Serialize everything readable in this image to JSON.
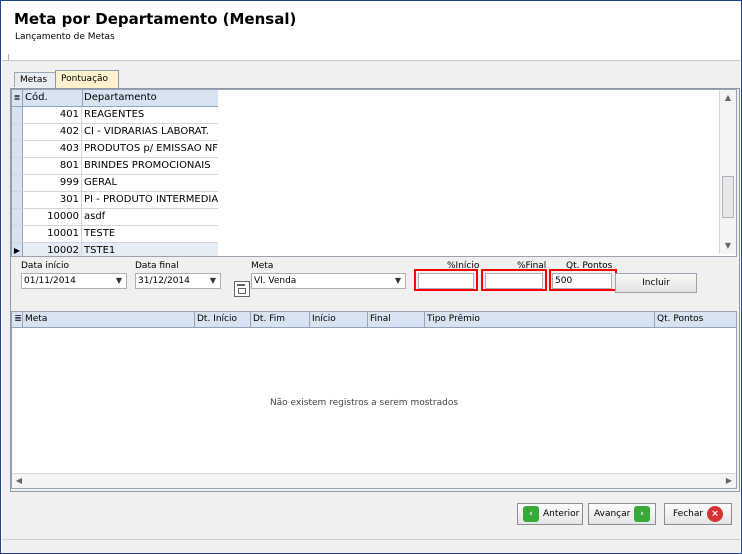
{
  "window": {
    "title": "Meta por Departamento (Mensal)",
    "subtitle": "Lançamento de Metas"
  },
  "tabs": [
    {
      "label": "Metas",
      "active": false
    },
    {
      "label": "Pontuação",
      "active": true
    }
  ],
  "department_grid": {
    "columns": [
      "Cód.",
      "Departamento"
    ],
    "rows": [
      {
        "code": "401",
        "name": "REAGENTES"
      },
      {
        "code": "402",
        "name": "CI - VIDRARIAS LABORAT."
      },
      {
        "code": "403",
        "name": "PRODUTOS p/ EMISSAO NF"
      },
      {
        "code": "801",
        "name": "BRINDES PROMOCIONAIS"
      },
      {
        "code": "999",
        "name": "GERAL"
      },
      {
        "code": "301",
        "name": "PI - PRODUTO INTERMEDIARI"
      },
      {
        "code": "10000",
        "name": "asdf"
      },
      {
        "code": "10001",
        "name": "TESTE"
      },
      {
        "code": "10002",
        "name": "TSTE1"
      }
    ]
  },
  "form": {
    "data_inicio_label": "Data início",
    "data_inicio_value": "01/11/2014",
    "data_final_label": "Data final",
    "data_final_value": "31/12/2014",
    "meta_label": "Meta",
    "meta_value": "Vl. Venda",
    "pct_inicio_label": "%Início",
    "pct_inicio_value": "",
    "pct_final_label": "%Final",
    "pct_final_value": "",
    "qt_pontos_label": "Qt. Pontos",
    "qt_pontos_value": "500",
    "incluir_label": "Incluir"
  },
  "results_grid": {
    "columns": [
      "Meta",
      "Dt. Início",
      "Dt. Fim",
      "Início",
      "Final",
      "Tipo Prêmio",
      "Qt. Pontos"
    ],
    "empty_message": "Não existem registros a serem mostrados"
  },
  "footer": {
    "anterior_label": "Anterior",
    "avancar_label": "Avançar",
    "fechar_label": "Fechar"
  },
  "icons": {
    "grid_selector": "grid-selector-icon",
    "calendar": "calendar-icon",
    "arrow_left": "arrow-left-icon",
    "arrow_right": "arrow-right-icon",
    "close": "close-icon"
  },
  "colors": {
    "highlight": "#ff0000",
    "tab_active": "#fff3cf",
    "grid_header": "#d7e3f1",
    "frame_border": "#1f3f8f"
  }
}
